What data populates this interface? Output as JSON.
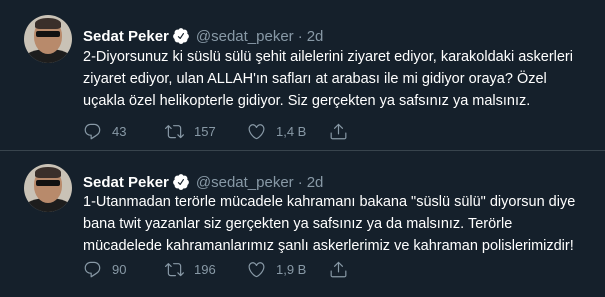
{
  "tweets": [
    {
      "author": "Sedat Peker",
      "handle": "@sedat_peker",
      "dot": "·",
      "time": "2d",
      "text": "2-Diyorsunuz ki süslü sülü şehit ailelerini ziyaret ediyor, karakoldaki askerleri\nziyaret ediyor, ulan ALLAH'ın safları at arabası ile mi gidiyor oraya? Özel\nuçakla özel helikopterle gidiyor. Siz gerçekten ya safsınız ya malsınız.",
      "replies": "43",
      "retweets": "157",
      "likes": "1,4 B"
    },
    {
      "author": "Sedat Peker",
      "handle": "@sedat_peker",
      "dot": "·",
      "time": "2d",
      "text": "1-Utanmadan terörle mücadele kahramanı bakana \"süslü sülü\" diyorsun diye\nbana twit yazanlar siz gerçekten ya safsınız ya da malsınız. Terörle\nmücadelede kahramanlarımız şanlı askerlerimiz ve kahraman polislerimizdir!",
      "replies": "90",
      "retweets": "196",
      "likes": "1,9 B"
    }
  ],
  "colors": {
    "background": "#15202b",
    "secondary_text": "#8899a6",
    "divider": "#38444d",
    "primary_text": "#ffffff"
  },
  "icons": {
    "verified": "verified-badge-icon",
    "reply": "reply-icon",
    "retweet": "retweet-icon",
    "like": "heart-icon",
    "share": "share-icon"
  }
}
